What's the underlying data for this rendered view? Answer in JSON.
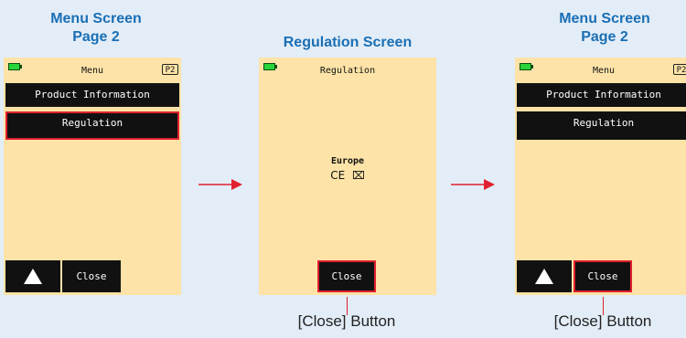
{
  "captions": {
    "left": [
      "Menu Screen",
      "Page 2"
    ],
    "middle": [
      "Regulation Screen"
    ],
    "right": [
      "Menu Screen",
      "Page 2"
    ]
  },
  "menu_screen": {
    "title": "Menu",
    "page_badge": "P2",
    "items": [
      "Product Information",
      "Regulation"
    ],
    "close_label": "Close"
  },
  "regulation_screen": {
    "title": "Regulation",
    "region": "Europe",
    "marks": [
      "CE",
      "⌧"
    ],
    "close_label": "Close"
  },
  "callouts": {
    "close_button": "[Close] Button"
  },
  "colors": {
    "screen_bg": "#fde3a7",
    "highlight": "#e0202e",
    "caption": "#1a6fb5",
    "battery": "#27d43a"
  }
}
